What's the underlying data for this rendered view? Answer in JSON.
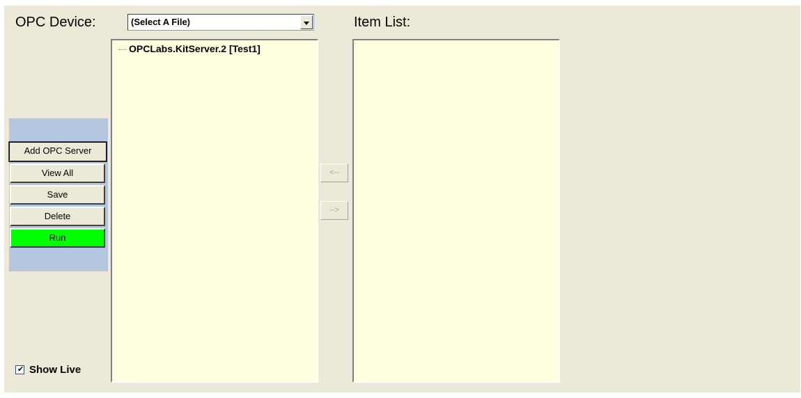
{
  "header": {
    "device_label": "OPC Device:",
    "item_list_label": "Item List:"
  },
  "device_select": {
    "selected_value": "(Select A File)"
  },
  "tree": {
    "items": [
      {
        "label": "OPCLabs.KitServer.2 [Test1]"
      }
    ]
  },
  "actions": {
    "add_server": "Add OPC Server",
    "view_all": "View All",
    "save": "Save",
    "delete": "Delete",
    "run": "Run"
  },
  "transfer": {
    "left": "<--",
    "right": "-->"
  },
  "options": {
    "show_live_label": "Show Live",
    "show_live_checked": true
  },
  "colors": {
    "panel_bg": "#ece9d8",
    "list_bg": "#ffffe0",
    "side_panel_bg": "#b4c6e0",
    "run_button_bg": "#00ff00"
  }
}
